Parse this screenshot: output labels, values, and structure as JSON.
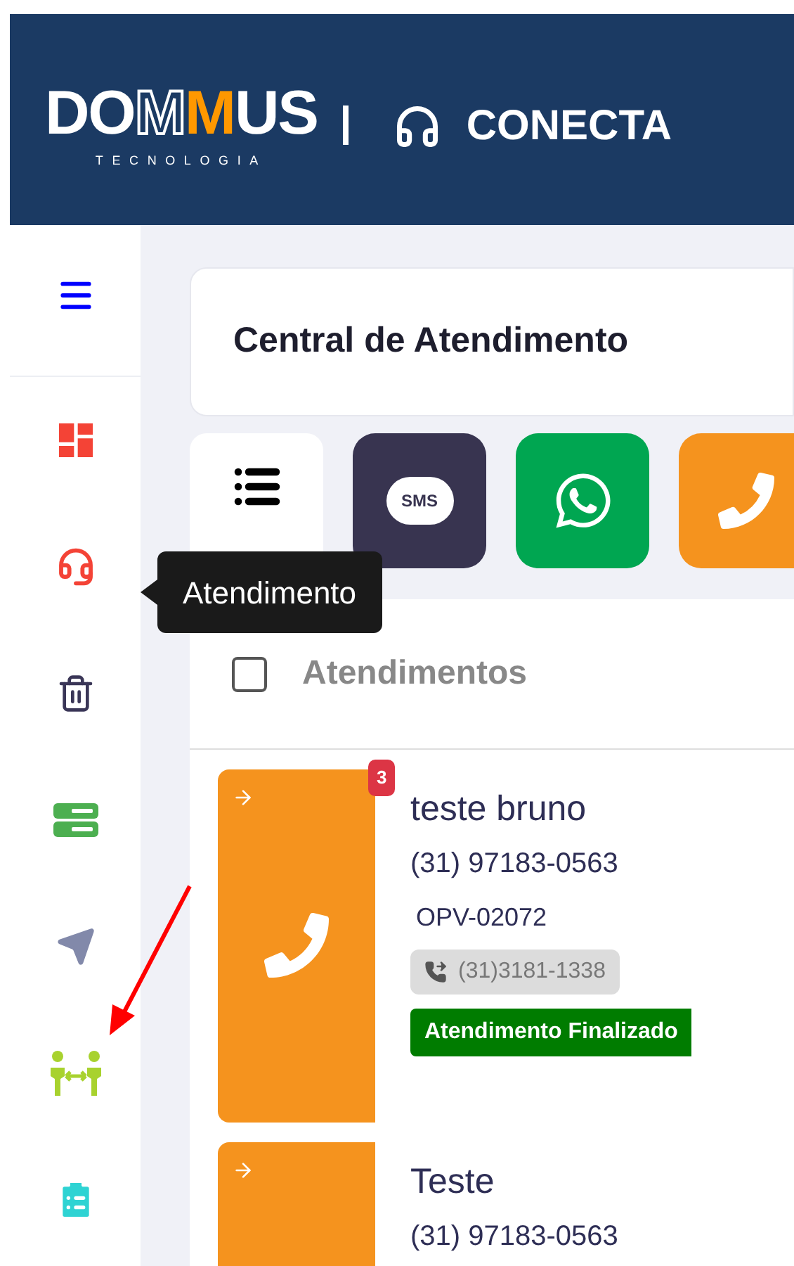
{
  "header": {
    "logo": {
      "word_start": "DO",
      "word_outline": "M",
      "word_accent": "M",
      "word_end": "US",
      "tagline": "TECNOLOGIA"
    },
    "product": "CONECTA"
  },
  "sidebar": {
    "items": [
      {
        "kind": "menu",
        "color": "#0000ff"
      },
      {
        "kind": "dashboard",
        "color": "#f44336"
      },
      {
        "kind": "headset",
        "color": "#f44336"
      },
      {
        "kind": "trash",
        "color": "#3a3657"
      },
      {
        "kind": "server",
        "color": "#4caf50"
      },
      {
        "kind": "send",
        "color": "#8289aa"
      },
      {
        "kind": "people",
        "color": "#a8d22e"
      },
      {
        "kind": "clipboard",
        "color": "#2ed3d3"
      }
    ]
  },
  "tooltip": "Atendimento",
  "page_title": "Central de Atendimento",
  "channel_tabs": [
    {
      "kind": "list",
      "selected": true
    },
    {
      "kind": "sms",
      "label": "SMS",
      "selected": false
    },
    {
      "kind": "whatsapp",
      "selected": false
    },
    {
      "kind": "phone",
      "selected": false
    }
  ],
  "list": {
    "title": "Atendimentos",
    "select_all_checked": false,
    "items": [
      {
        "name": "teste bruno",
        "phone": "(31) 97183-0563",
        "code": "OPV-02072",
        "line": "(31)3181-1338",
        "status": "Atendimento Finalizado",
        "badge": "3"
      },
      {
        "name": "Teste",
        "phone": "(31) 97183-0563"
      }
    ]
  }
}
